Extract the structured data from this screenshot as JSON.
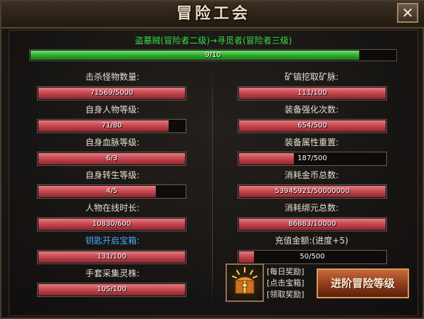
{
  "window": {
    "title": "冒险工会",
    "close_label": "✕"
  },
  "rank": {
    "text": "盗墓贼(冒险者二级)→寻觅者(冒险者三级)",
    "progress_label": "9/10",
    "progress_fraction": 0.9
  },
  "left_stats": [
    {
      "label": "击杀怪物数量:",
      "value": "71569/5000",
      "fraction": 1.0,
      "label_color": "white"
    },
    {
      "label": "自身人物等级:",
      "value": "71/80",
      "fraction": 0.8875,
      "label_color": "white"
    },
    {
      "label": "自身血脉等级:",
      "value": "6/3",
      "fraction": 1.0,
      "label_color": "white"
    },
    {
      "label": "自身转生等级:",
      "value": "4/5",
      "fraction": 0.8,
      "label_color": "white"
    },
    {
      "label": "人物在线时长:",
      "value": "10830/600",
      "fraction": 1.0,
      "label_color": "white"
    },
    {
      "label": "钥匙开启宝箱:",
      "value": "131/100",
      "fraction": 1.0,
      "label_color": "blue"
    },
    {
      "label": "手套采集灵株:",
      "value": "105/100",
      "fraction": 1.0,
      "label_color": "white"
    }
  ],
  "right_stats": [
    {
      "label": "矿镐挖取矿脉:",
      "value": "111/100",
      "fraction": 1.0
    },
    {
      "label": "装备强化次数:",
      "value": "654/500",
      "fraction": 1.0
    },
    {
      "label": "装备属性重置:",
      "value": "187/500",
      "fraction": 0.374
    },
    {
      "label": "消耗金币总数:",
      "value": "53945921/50000000",
      "fraction": 1.0
    },
    {
      "label": "消耗绑元总数:",
      "value": "86883/10000",
      "fraction": 1.0
    },
    {
      "label": "充值金额:(进度+5)",
      "value": "50/500",
      "fraction": 0.1
    }
  ],
  "rewards": {
    "daily_reward": "[每日奖励]",
    "click_chest": "[点击宝箱]",
    "claim_reward": "[领取奖励]",
    "advance_button": "进阶冒险等级"
  },
  "colors": {
    "rank_text": "#36d94a",
    "highlight_label": "#4aa7ff",
    "bar_fill": "#c64a52",
    "xp_fill": "#2ea52c"
  }
}
